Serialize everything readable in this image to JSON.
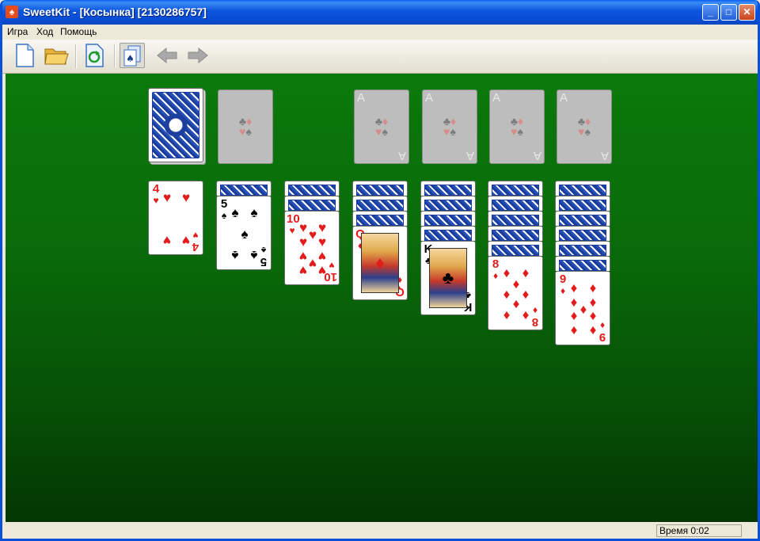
{
  "window": {
    "title": "SweetKit - [Косынка] [2130286757]",
    "minimize": "_",
    "maximize": "□",
    "close": "✕"
  },
  "menu": [
    "Игра",
    "Ход",
    "Помощь"
  ],
  "toolbar": {
    "icons": [
      "new-game-icon",
      "open-folder-icon",
      "restart-icon",
      "deal-cards-icon",
      "undo-arrow-icon",
      "redo-arrow-icon"
    ]
  },
  "status": {
    "time": "Время 0:02"
  },
  "colors": {
    "felt": "#0b7a0b",
    "card_red": "#e21b1b",
    "card_back": "#2450b8",
    "slot": "#bdbdbd"
  },
  "foundations": [
    {
      "letter": "A"
    },
    {
      "letter": "A"
    },
    {
      "letter": "A"
    },
    {
      "letter": "A"
    }
  ],
  "tableau": [
    {
      "hidden": 0,
      "rank": "4",
      "suit": "♥",
      "color": "red"
    },
    {
      "hidden": 1,
      "rank": "5",
      "suit": "♠",
      "color": "blk"
    },
    {
      "hidden": 2,
      "rank": "10",
      "suit": "♥",
      "color": "red"
    },
    {
      "hidden": 3,
      "rank": "Q",
      "suit": "♦",
      "color": "red"
    },
    {
      "hidden": 4,
      "rank": "K",
      "suit": "♣",
      "color": "blk"
    },
    {
      "hidden": 5,
      "rank": "8",
      "suit": "♦",
      "color": "red"
    },
    {
      "hidden": 6,
      "rank": "9",
      "suit": "♦",
      "color": "red"
    }
  ]
}
